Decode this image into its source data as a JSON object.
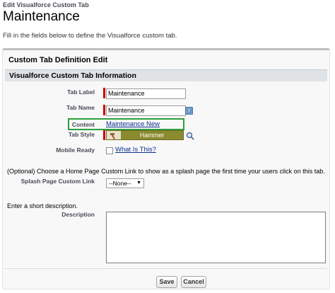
{
  "page": {
    "breadcrumb": "Edit Visualforce Custom Tab",
    "title": "Maintenance",
    "intro": "Fill in the fields below to define the Visualforce custom tab."
  },
  "panel": {
    "title": "Custom Tab Definition Edit",
    "section_title": "Visualforce Custom Tab Information"
  },
  "fields": {
    "tab_label": {
      "label": "Tab Label",
      "value": "Maintenance"
    },
    "tab_name": {
      "label": "Tab Name",
      "value": "Maintenance",
      "info_icon": "i"
    },
    "content": {
      "label": "Content",
      "value": "Maintenance New"
    },
    "tab_style": {
      "label": "Tab Style",
      "value": "Hammer",
      "icon": "hammer-icon",
      "swatch_color": "#8b8a2d"
    },
    "mobile_ready": {
      "label": "Mobile Ready",
      "link": "What Is This?",
      "checked": false
    }
  },
  "splash": {
    "instruction": "(Optional) Choose a Home Page Custom Link to show as a splash page the first time your users click on this tab.",
    "label": "Splash Page Custom Link",
    "selected": "--None--"
  },
  "description": {
    "instruction": "Enter a short description.",
    "label": "Description",
    "value": ""
  },
  "buttons": {
    "save": "Save",
    "cancel": "Cancel"
  },
  "colors": {
    "required": "#cc0000",
    "highlight": "#2e9e3f",
    "link": "#0b2f8f"
  }
}
